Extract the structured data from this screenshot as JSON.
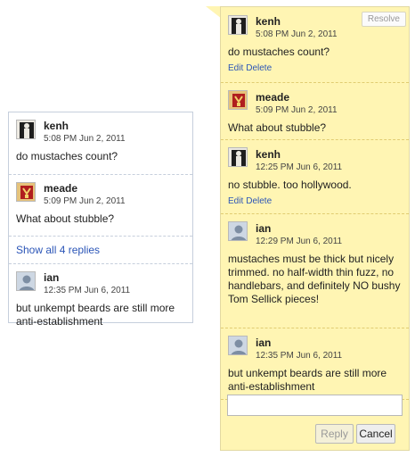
{
  "left_card": {
    "comments": [
      {
        "author": "kenh",
        "time": "5:08 PM Jun 2, 2011",
        "text": "do mustaches count?",
        "avatar_icon": "silhouette-icon"
      },
      {
        "author": "meade",
        "time": "5:09 PM Jun 2, 2011",
        "text": "What about stubble?",
        "avatar_icon": "crest-icon"
      }
    ],
    "show_all_label": "Show all 4 replies",
    "last_comment": {
      "author": "ian",
      "time": "12:35 PM Jun 6, 2011",
      "text": "but unkempt beards are still more anti-establishment",
      "avatar_icon": "default-person-icon"
    }
  },
  "right_panel": {
    "resolve_label": "Resolve",
    "edit_label": "Edit",
    "delete_label": "Delete",
    "comments": [
      {
        "author": "kenh",
        "time": "5:08 PM Jun 2, 2011",
        "text": "do mustaches count?",
        "editable": true
      },
      {
        "author": "meade",
        "time": "5:09 PM Jun 2, 2011",
        "text": "What about stubble?",
        "editable": false
      },
      {
        "author": "kenh",
        "time": "12:25 PM Jun 6, 2011",
        "text": "no stubble. too hollywood.",
        "editable": true
      },
      {
        "author": "ian",
        "time": "12:29 PM Jun 6, 2011",
        "text": "mustaches must be thick but nicely trimmed. no half-width thin fuzz, no handlebars, and definitely NO bushy Tom Sellick pieces!",
        "editable": false
      },
      {
        "author": "ian",
        "time": "12:35 PM Jun 6, 2011",
        "text": "but unkempt beards are still more anti-establishment",
        "editable": false
      }
    ],
    "reply_placeholder": "",
    "reply_label": "Reply",
    "cancel_label": "Cancel"
  },
  "colors": {
    "panel_bg": "#fff5b3",
    "link": "#2b55b7",
    "card_border": "#c6cfdc"
  }
}
